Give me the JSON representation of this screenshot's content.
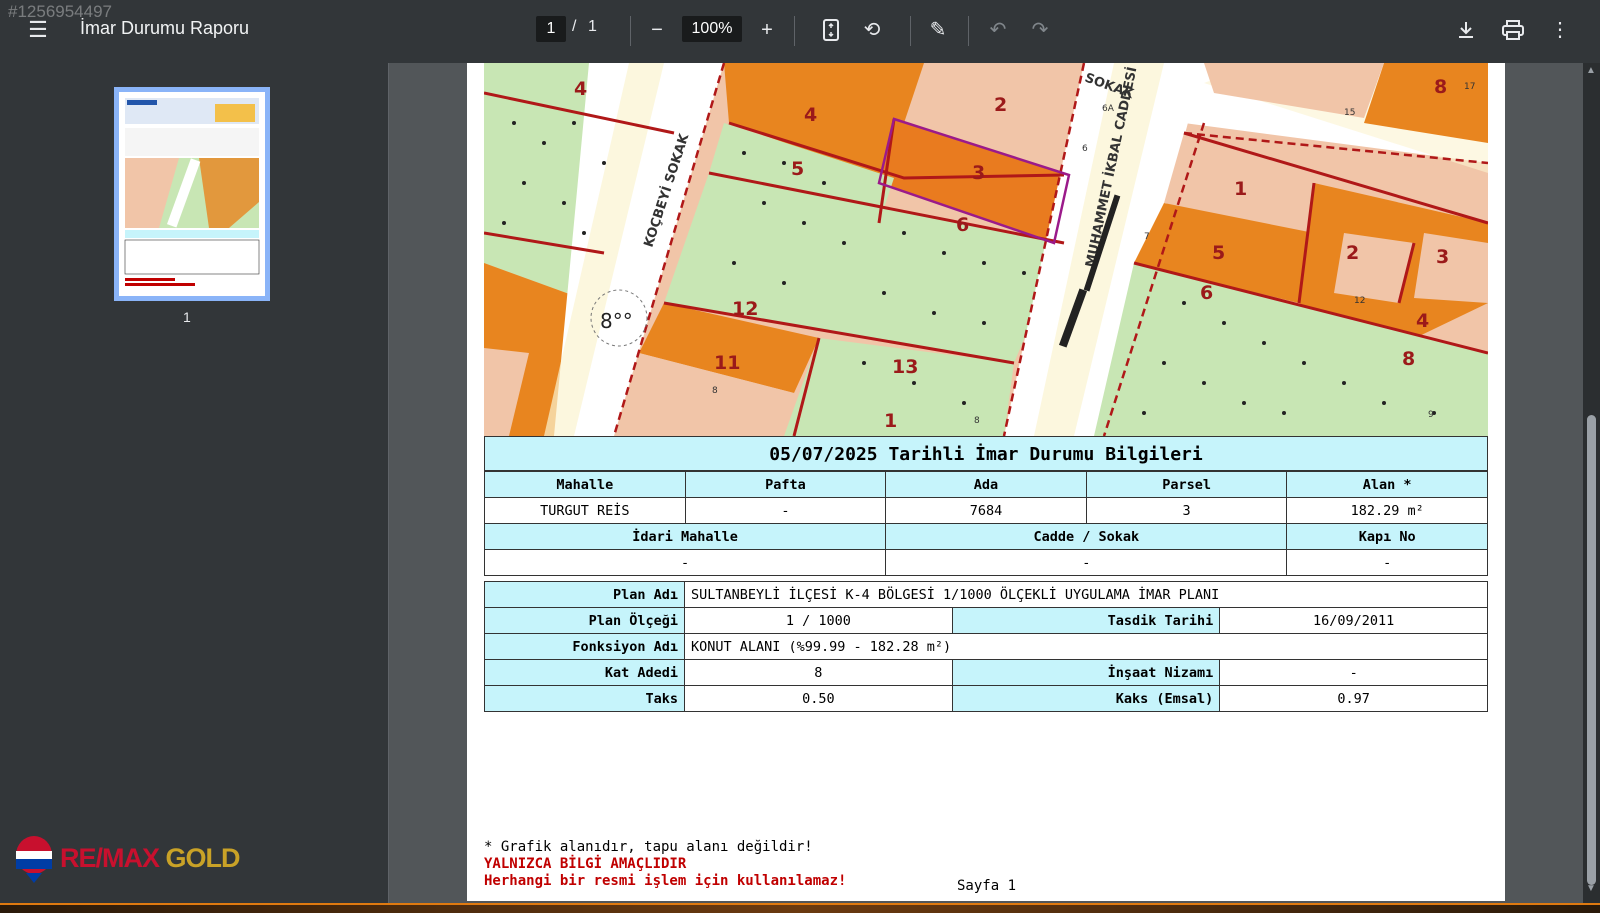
{
  "toolbar": {
    "image_id": "#1256954497",
    "title": "İmar Durumu Raporu",
    "current_page": "1",
    "separator": "/",
    "total_pages": "1",
    "zoom": "100%"
  },
  "sidebar": {
    "thumbnail_page": "1"
  },
  "branding": {
    "logo_text": "RE/MAX GOLD"
  },
  "map": {
    "street_labels": [
      "KOÇBEYİ SOKAK",
      "MUHAMMET İKBAL CADDESİ",
      "SOKAK"
    ],
    "parcels": [
      "4",
      "4",
      "2",
      "5",
      "3",
      "6",
      "1",
      "5",
      "2",
      "3",
      "6",
      "4",
      "12",
      "8",
      "11",
      "13",
      "1",
      "8"
    ],
    "door_numbers": [
      "6A",
      "6",
      "15",
      "17",
      "12",
      "8",
      "8",
      "9",
      "7",
      "8°°"
    ]
  },
  "report": {
    "heading": "05/07/2025 Tarihli İmar Durumu Bilgileri",
    "row1_headers": [
      "Mahalle",
      "Pafta",
      "Ada",
      "Parsel",
      "Alan *"
    ],
    "row1_values": [
      "TURGUT REİS",
      "-",
      "7684",
      "3",
      "182.29 m²"
    ],
    "row2_headers": [
      "İdari Mahalle",
      "Cadde / Sokak",
      "Kapı No"
    ],
    "row2_values": [
      "-",
      "-",
      "-"
    ],
    "plan": {
      "plan_adi_label": "Plan Adı",
      "plan_adi": "SULTANBEYLİ İLÇESİ K-4 BÖLGESİ 1/1000 ÖLÇEKLİ UYGULAMA İMAR PLANI",
      "plan_olcegi_label": "Plan Ölçeği",
      "plan_olcegi": "1 / 1000",
      "tasdik_label": "Tasdik Tarihi",
      "tasdik": "16/09/2011",
      "fonksiyon_label": "Fonksiyon Adı",
      "fonksiyon": "KONUT ALANI (%99.99 - 182.28 m²)",
      "kat_label": "Kat Adedi",
      "kat": "8",
      "insaat_label": "İnşaat Nizamı",
      "insaat": "-",
      "taks_label": "Taks",
      "taks": "0.50",
      "kaks_label": "Kaks (Emsal)",
      "kaks": "0.97"
    }
  },
  "footer": {
    "note": "* Grafik alanıdır, tapu alanı değildir!",
    "warning1": "YALNIZCA BİLGİ AMAÇLIDIR",
    "warning2": "Herhangi bir resmi işlem için kullanılamaz!",
    "page_label": "Sayfa 1"
  },
  "colors": {
    "toolbar": "#323639",
    "table_header": "#c6f4fb",
    "orange": "#e8851f",
    "green_area": "#c8e6b4",
    "warning_red": "#c00000"
  }
}
